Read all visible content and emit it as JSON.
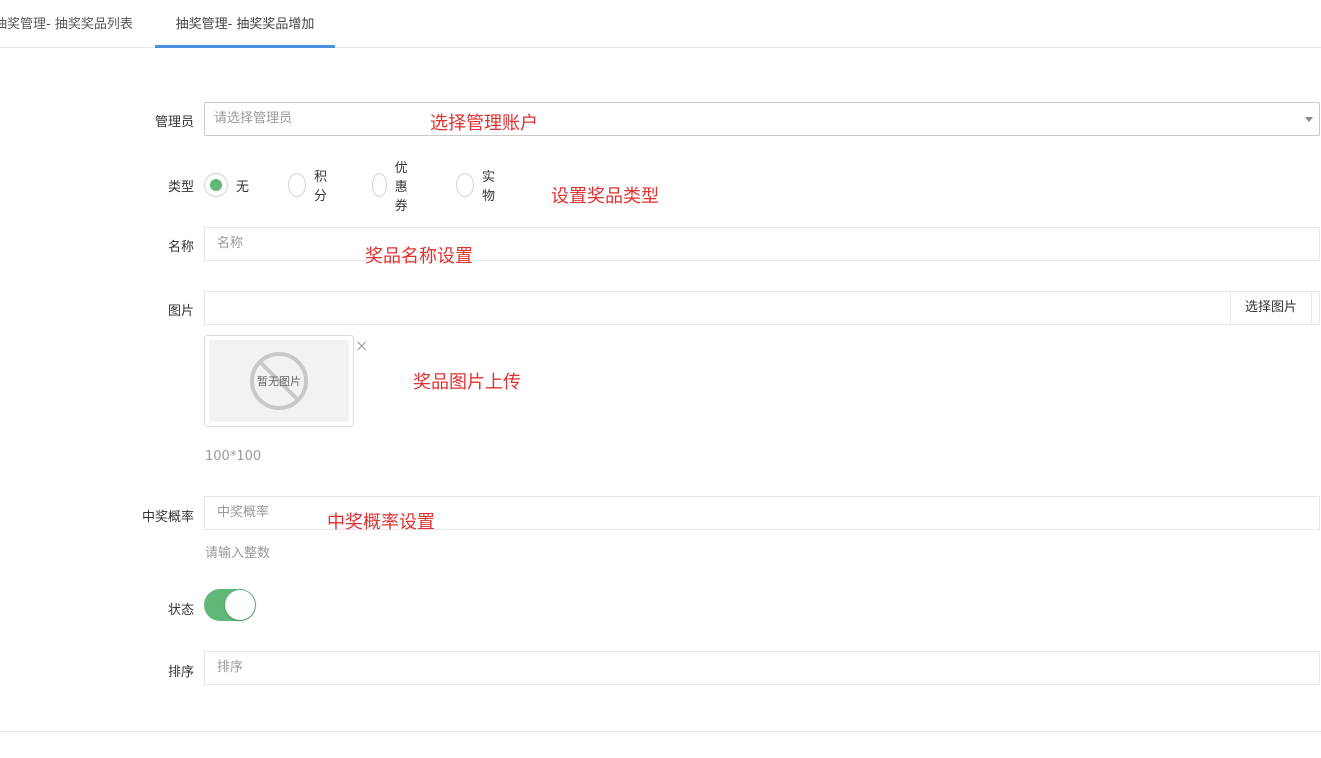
{
  "tabs": [
    {
      "label": "抽奖管理- 抽奖奖品列表"
    },
    {
      "label": "抽奖管理- 抽奖奖品增加"
    }
  ],
  "form": {
    "admin": {
      "label": "管理员",
      "placeholder": "请选择管理员",
      "note": "选择管理账户"
    },
    "type": {
      "label": "类型",
      "options": [
        "无",
        "积分",
        "优惠券",
        "实物"
      ],
      "selected": "无",
      "note": "设置奖品类型"
    },
    "name": {
      "label": "名称",
      "placeholder": "名称",
      "note": "奖品名称设置"
    },
    "image": {
      "label": "图片",
      "button": "选择图片",
      "thumb_text": "暂无图片",
      "remove_icon": "×",
      "size_hint": "100*100",
      "note": "奖品图片上传"
    },
    "probability": {
      "label": "中奖概率",
      "placeholder": "中奖概率",
      "hint": "请输入整数",
      "note": "中奖概率设置"
    },
    "status": {
      "label": "状态",
      "on": true
    },
    "sort": {
      "label": "排序",
      "placeholder": "排序"
    }
  },
  "colors": {
    "accent": "#5fb878",
    "tab_active": "#4a90e2",
    "note": "#e03131"
  }
}
